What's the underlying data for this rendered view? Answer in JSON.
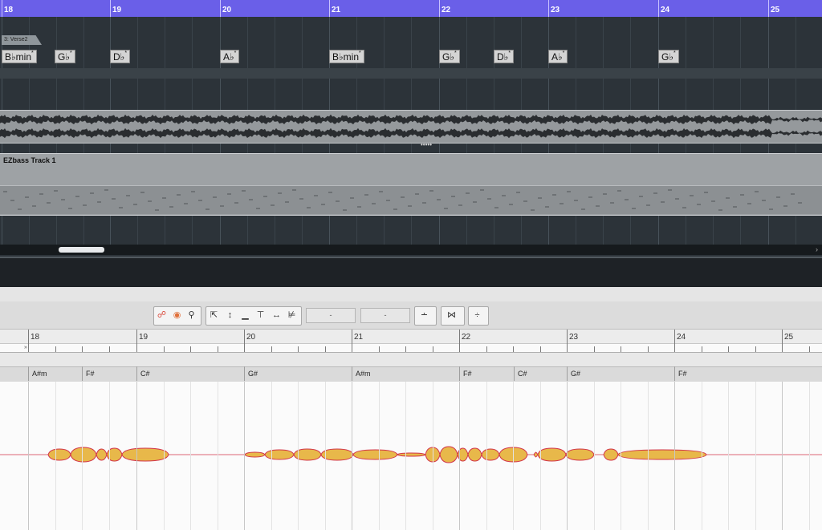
{
  "arrange": {
    "ruler_bars": [
      "18",
      "19",
      "20",
      "21",
      "22",
      "23",
      "24",
      "25"
    ],
    "section_label": "3: Verse2",
    "chord_track": [
      {
        "root": "B♭",
        "quality": "min",
        "sup": "*"
      },
      {
        "root": "G♭",
        "quality": "",
        "sup": "*"
      },
      {
        "root": "D♭",
        "quality": "",
        "sup": "*"
      },
      {
        "root": "A♭",
        "quality": "",
        "sup": "*"
      },
      {
        "root": "B♭",
        "quality": "min",
        "sup": "*"
      },
      {
        "root": "G♭",
        "quality": "",
        "sup": "*"
      },
      {
        "root": "D♭",
        "quality": "",
        "sup": "*"
      },
      {
        "root": "A♭",
        "quality": "",
        "sup": "*"
      },
      {
        "root": "G♭",
        "quality": "",
        "sup": "*"
      }
    ],
    "midi_track_name": "EZbass Track 1",
    "resize_handle": "•••••",
    "scroll_arrow": "›",
    "accent_color": "#6a5fe8"
  },
  "editor": {
    "ruler_bars": [
      "18",
      "19",
      "20",
      "21",
      "22",
      "23",
      "24",
      "25"
    ],
    "ruler_marker": "»",
    "chords": [
      "A#m",
      "F#",
      "C#",
      "G#",
      "A#m",
      "F#",
      "C#",
      "G#",
      "F#"
    ],
    "toolbar": {
      "field_left": "-",
      "field_right": "-",
      "icons": [
        "link-icon",
        "eraser-icon",
        "wrench-icon",
        "pointer-icon",
        "pitch-move-icon",
        "quantize-icon",
        "tempo-icon",
        "stretch-icon",
        "split-icon",
        "snap-icon",
        "fit-icon",
        "align-icon"
      ]
    },
    "blob_color": "#e8b84a",
    "blob_outline_color": "#d2344a"
  }
}
